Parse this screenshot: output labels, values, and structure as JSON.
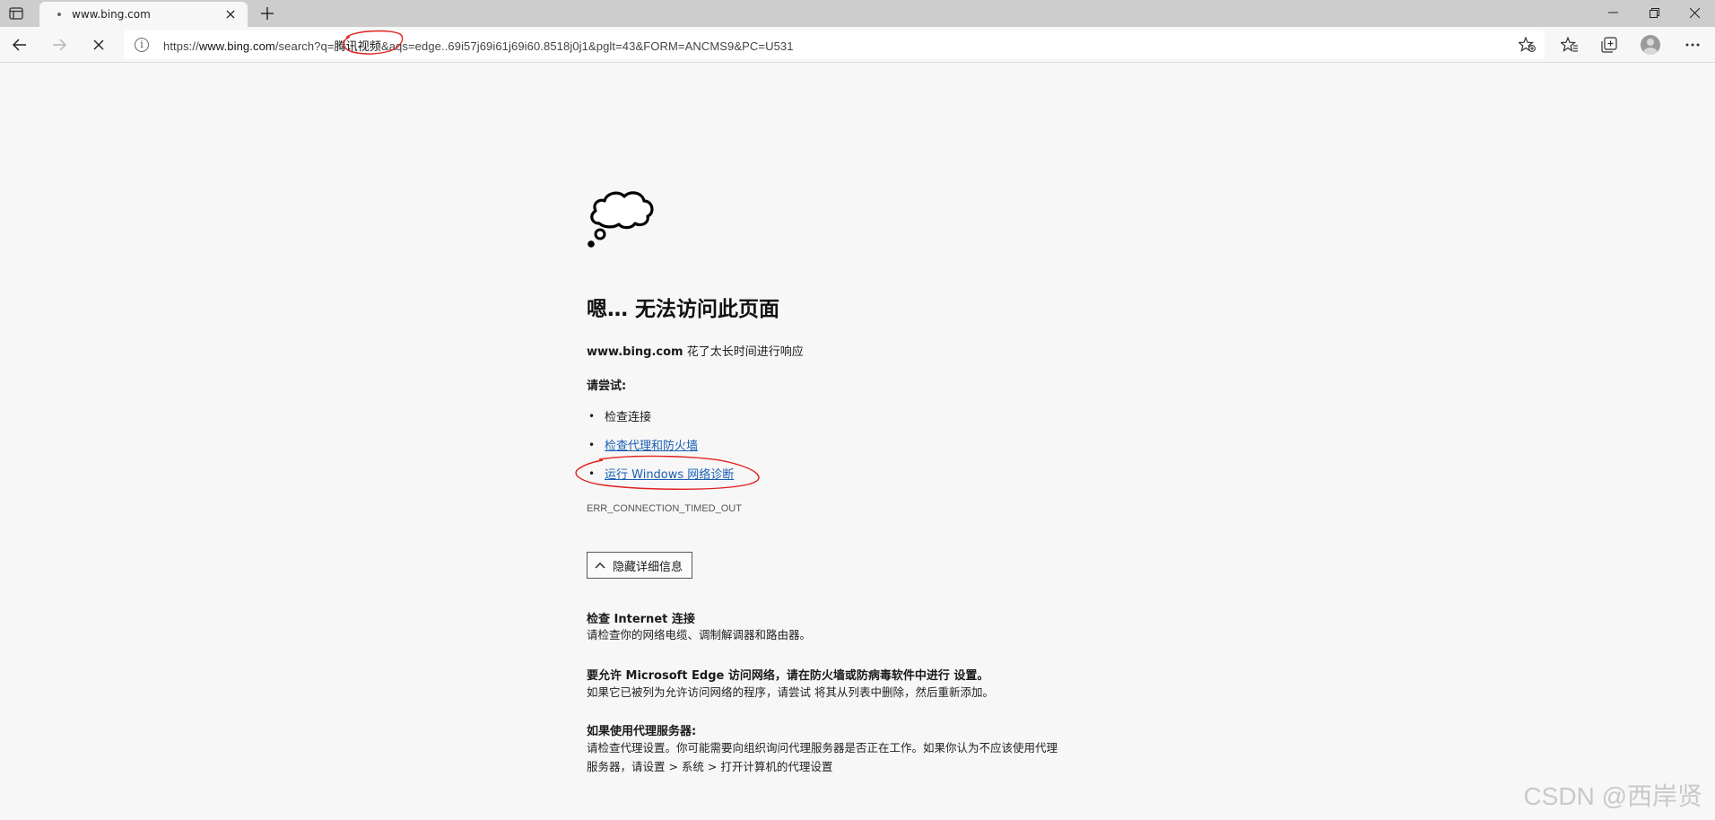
{
  "tab": {
    "title": "www.bing.com"
  },
  "address": {
    "prefix": "https://",
    "host": "www.bing.com",
    "path_before": "/search?q=",
    "query": "腾讯视频",
    "path_after": "&aqs=edge..69i57j69i61j69i60.8518j0j1&pglt=43&FORM=ANCMS9&PC=U531"
  },
  "error": {
    "title": "嗯… 无法访问此页面",
    "site": "www.bing.com",
    "desc_suffix": " 花了太长时间进行响应",
    "try_label": "请尝试:",
    "suggestions": [
      {
        "text": "检查连接",
        "link": false
      },
      {
        "text": "检查代理和防火墙",
        "link": true
      },
      {
        "text": "运行 Windows 网络诊断",
        "link": true
      }
    ],
    "code": "ERR_CONNECTION_TIMED_OUT",
    "details_button": "隐藏详细信息"
  },
  "details": [
    {
      "heading": "检查 Internet 连接",
      "lines": [
        "请检查你的网络电缆、调制解调器和路由器。"
      ]
    },
    {
      "heading": "要允许 Microsoft Edge 访问网络，请在防火墙或防病毒软件中进行 设置。",
      "lines": [
        "如果它已被列为允许访问网络的程序，请尝试 将其从列表中删除，然后重新添加。"
      ]
    },
    {
      "heading": "如果使用代理服务器:",
      "lines": [
        "请检查代理设置。你可能需要向组织询问代理服务器是否正在工作。如果你认为不应该使用代理",
        "服务器，请设置 > 系统 > 打开计算机的代理设置"
      ]
    }
  ],
  "watermark": "CSDN @西岸贤",
  "colors": {
    "link": "#1a5fb4",
    "annotation": "#e02020",
    "page_bg": "#f7f7f7",
    "tabstrip_bg": "#cdcdcd"
  },
  "icons": [
    "tab-actions-icon",
    "tab-favicon-dot",
    "close-icon",
    "plus-icon",
    "minimize-icon",
    "restore-icon",
    "window-close-icon",
    "back-arrow-icon",
    "forward-arrow-icon",
    "stop-loading-icon",
    "info-icon",
    "favorite-add-icon",
    "favorites-icon",
    "collections-icon",
    "profile-avatar",
    "more-icon",
    "cloud-thought-icon",
    "chevron-up-icon"
  ]
}
